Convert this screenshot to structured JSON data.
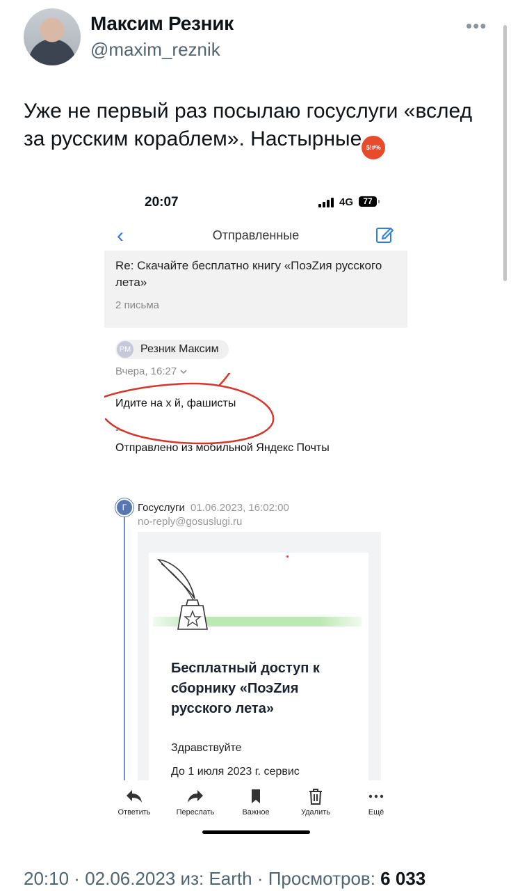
{
  "tweet": {
    "author_name": "Максим Резник",
    "handle": "@maxim_reznik",
    "more": "•••",
    "text": "Уже не первый раз посылаю госуслуги «вслед за русским кораблем». Настырные",
    "emoji": "$!#%",
    "time": "20:10",
    "sep1": " · ",
    "date": "02.06.2023",
    "source": " из: Earth",
    "sep2": " · ",
    "views_label": "Просмотров: ",
    "views": "6 033"
  },
  "phone": {
    "status": {
      "time": "20:07",
      "network": "4G",
      "battery": "77"
    },
    "nav": {
      "back": "‹",
      "title": "Отправленные"
    },
    "thread": {
      "subject": "Re: Скачайте бесплатно книгу «ПоэZия русского лета»",
      "count": "2 письма"
    },
    "message": {
      "avatar_initials": "РМ",
      "sender": "Резник Максим",
      "when": "Вчера, 16:27",
      "body": "Идите на х  й, фашисты",
      "signature_dash": "--",
      "signature": "Отправлено из мобильной Яндекс Почты"
    },
    "quoted": {
      "icon_letter": "Г",
      "sender": "Госуслуги",
      "date": "01.06.2023, 16:02:00",
      "email": "no-reply@gosuslugi.ru",
      "title": "Бесплатный доступ к сборнику «ПоэZия русского лета»",
      "greeting": "Здравствуйте",
      "text": "До 1 июля 2023 г. сервис"
    },
    "toolbar": [
      {
        "label": "Ответить",
        "icon": "reply-icon"
      },
      {
        "label": "Переслать",
        "icon": "forward-icon"
      },
      {
        "label": "Важное",
        "icon": "bookmark-icon"
      },
      {
        "label": "Удалить",
        "icon": "trash-icon"
      },
      {
        "label": "Ещё",
        "icon": "more-icon"
      }
    ]
  },
  "colors": {
    "accent": "#2f7de1",
    "scribble": "#d9352b",
    "handle": "#536471"
  }
}
